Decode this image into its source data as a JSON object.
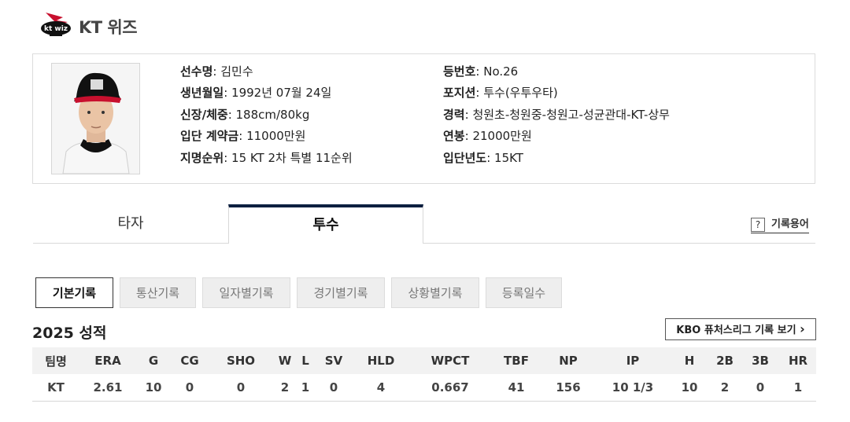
{
  "header": {
    "team_name": "KT 위즈",
    "logo_text": "kt wiz"
  },
  "profile": {
    "left": [
      {
        "label": "선수명",
        "value": "김민수"
      },
      {
        "label": "생년월일",
        "value": "1992년 07월 24일"
      },
      {
        "label": "신장/체중",
        "value": "188cm/80kg"
      },
      {
        "label": "입단 계약금",
        "value": "11000만원"
      },
      {
        "label": "지명순위",
        "value": "15 KT 2차 특별 11순위"
      }
    ],
    "right": [
      {
        "label": "등번호",
        "value": "No.26"
      },
      {
        "label": "포지션",
        "value": "투수(우투우타)"
      },
      {
        "label": "경력",
        "value": "청원초-청원중-청원고-성균관대-KT-상무"
      },
      {
        "label": "연봉",
        "value": "21000만원"
      },
      {
        "label": "입단년도",
        "value": "15KT"
      }
    ]
  },
  "tabs": {
    "batter": "타자",
    "pitcher": "투수",
    "glossary": "기록용어",
    "glossary_icon": "?"
  },
  "subtabs": [
    "기본기록",
    "통산기록",
    "일자별기록",
    "경기별기록",
    "상황별기록",
    "등록일수"
  ],
  "season": {
    "title": "2025 성적",
    "futures_button": "KBO 퓨처스리그 기록 보기",
    "futures_arrow": "›"
  },
  "stats": {
    "headers": [
      "팀명",
      "ERA",
      "G",
      "CG",
      "SHO",
      "W",
      "L",
      "SV",
      "HLD",
      "WPCT",
      "TBF",
      "NP",
      "IP",
      "H",
      "2B",
      "3B",
      "HR"
    ],
    "row": [
      "KT",
      "2.61",
      "10",
      "0",
      "0",
      "2",
      "1",
      "0",
      "4",
      "0.667",
      "41",
      "156",
      "10 1/3",
      "10",
      "2",
      "0",
      "1"
    ]
  },
  "colors": {
    "accent": "#0b1f3f",
    "logo_red": "#c8102e",
    "border": "#dcdcdc"
  }
}
